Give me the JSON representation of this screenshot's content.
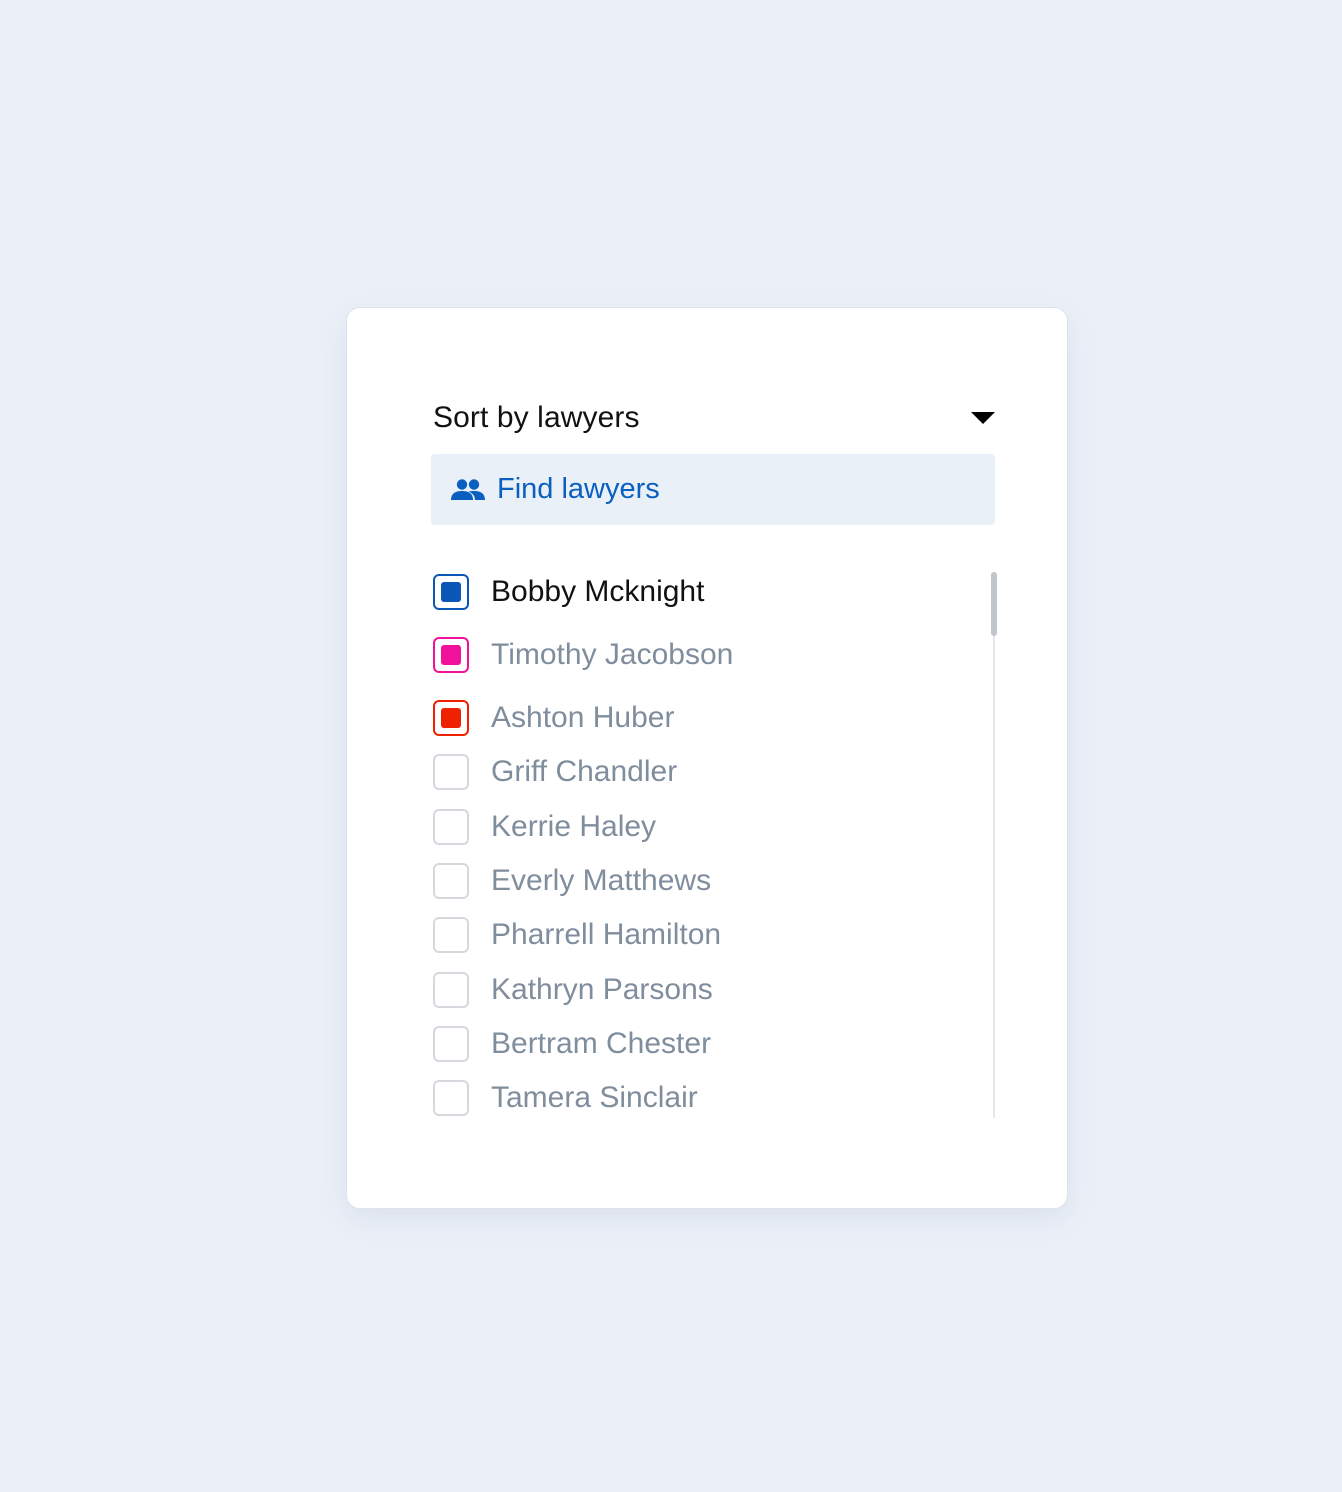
{
  "panel": {
    "title": "Sort by lawyers",
    "caret_icon": "caret-down-icon"
  },
  "search": {
    "icon": "people-icon",
    "placeholder": "Find lawyers",
    "value": ""
  },
  "colors": {
    "page_background": "#ebf0f8",
    "accent_blue": "#0b5fbf",
    "pink": "#f0129a",
    "red": "#ee2200",
    "unchecked_border": "#d5d8dd"
  },
  "lawyers": [
    {
      "name": "Bobby Mcknight",
      "checked": true,
      "color": "#0b57b8",
      "active": true
    },
    {
      "name": "Timothy Jacobson",
      "checked": true,
      "color": "#f0129a",
      "active": false
    },
    {
      "name": "Ashton Huber",
      "checked": true,
      "color": "#ee2200",
      "active": false
    },
    {
      "name": "Griff Chandler",
      "checked": false,
      "active": false
    },
    {
      "name": "Kerrie Haley",
      "checked": false,
      "active": false
    },
    {
      "name": "Everly Matthews",
      "checked": false,
      "active": false
    },
    {
      "name": "Pharrell Hamilton",
      "checked": false,
      "active": false
    },
    {
      "name": "Kathryn Parsons",
      "checked": false,
      "active": false
    },
    {
      "name": "Bertram Chester",
      "checked": false,
      "active": false
    },
    {
      "name": "Tamera Sinclair",
      "checked": false,
      "active": false
    }
  ]
}
